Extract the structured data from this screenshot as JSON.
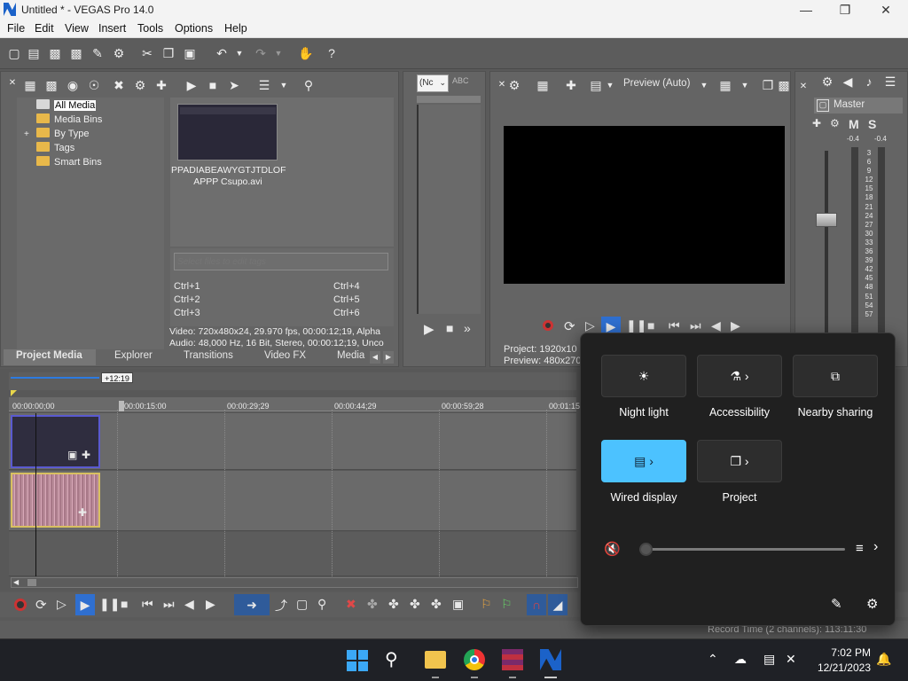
{
  "window": {
    "title": "Untitled * - VEGAS Pro 14.0"
  },
  "menu": [
    "File",
    "Edit",
    "View",
    "Insert",
    "Tools",
    "Options",
    "Help"
  ],
  "tree": {
    "items": [
      {
        "label": "All Media"
      },
      {
        "label": "Media Bins"
      },
      {
        "label": "By Type"
      },
      {
        "label": "Tags"
      },
      {
        "label": "Smart Bins"
      }
    ],
    "expander": "+"
  },
  "media": {
    "thumb_label": "PPADIABEAWYGTJTDLOF APPP Csupo.avi",
    "tags_placeholder": "Select files to edit tags",
    "shortcuts": [
      "Ctrl+1",
      "Ctrl+2",
      "Ctrl+3",
      "Ctrl+4",
      "Ctrl+5",
      "Ctrl+6"
    ],
    "video_info": "Video: 720x480x24, 29.970 fps, 00:00:12;19, Alpha",
    "audio_info": "Audio: 48,000 Hz, 16 Bit, Stereo, 00:00:12;19, Unco"
  },
  "tabs": [
    "Project Media",
    "Explorer",
    "Transitions",
    "Video FX",
    "Media"
  ],
  "trimmer": {
    "dropdown": "(Nc",
    "abc": "ABC"
  },
  "preview": {
    "mode": "Preview (Auto)",
    "project_label": "Project:",
    "project_value": "1920x10",
    "preview_label": "Preview:",
    "preview_value": "480x270"
  },
  "master": {
    "label": "Master",
    "left_peak": "-0.4",
    "right_peak": "-0.4",
    "m": "M",
    "s": "S",
    "scale": [
      "3",
      "6",
      "9",
      "12",
      "15",
      "18",
      "21",
      "24",
      "27",
      "30",
      "33",
      "36",
      "39",
      "42",
      "45",
      "48",
      "51",
      "54",
      "57"
    ]
  },
  "timeline": {
    "duration_badge": "+12:19",
    "timecodes": [
      "00:00:00;00",
      "00:00:15:00",
      "00:00:29;29",
      "00:00:44;29",
      "00:00:59;28",
      "00:01:15"
    ]
  },
  "status": {
    "record_time": "Record Time (2 channels): 113:11:30"
  },
  "quick_settings": {
    "tiles": [
      {
        "label": "Night light",
        "active": false
      },
      {
        "label": "Accessibility",
        "active": false
      },
      {
        "label": "Nearby sharing",
        "active": false
      },
      {
        "label": "Wired display",
        "active": true
      },
      {
        "label": "Project",
        "active": false
      }
    ],
    "volume_level": 0,
    "accent": "#4cc2ff"
  },
  "taskbar": {
    "time": "7:02 PM",
    "date": "12/21/2023"
  }
}
